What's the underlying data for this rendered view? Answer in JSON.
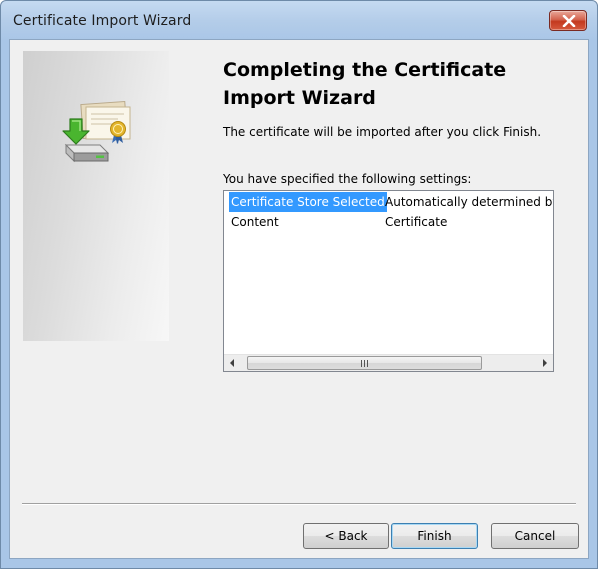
{
  "window": {
    "title": "Certificate Import Wizard",
    "close_icon": "close-x-icon"
  },
  "side_panel": {
    "icon": "certificate-import-icon"
  },
  "main": {
    "heading": "Completing the Certificate Import Wizard",
    "description": "The certificate will be imported after you click Finish.",
    "settings_label": "You have specified the following settings:"
  },
  "settings": {
    "rows": [
      {
        "name": "Certificate Store Selected",
        "value": "Automatically determined by t",
        "selected": true
      },
      {
        "name": "Content",
        "value": "Certificate",
        "selected": false
      }
    ],
    "scrollbar": {
      "left_icon": "scroll-left-arrow-icon",
      "right_icon": "scroll-right-arrow-icon",
      "grip_icon": "scroll-grip-icon"
    }
  },
  "buttons": {
    "back": "< Back",
    "finish": "Finish",
    "cancel": "Cancel"
  },
  "colors": {
    "selection": "#3399ff",
    "close_button": "#c3391e",
    "title_bar": "#b4cde9"
  }
}
